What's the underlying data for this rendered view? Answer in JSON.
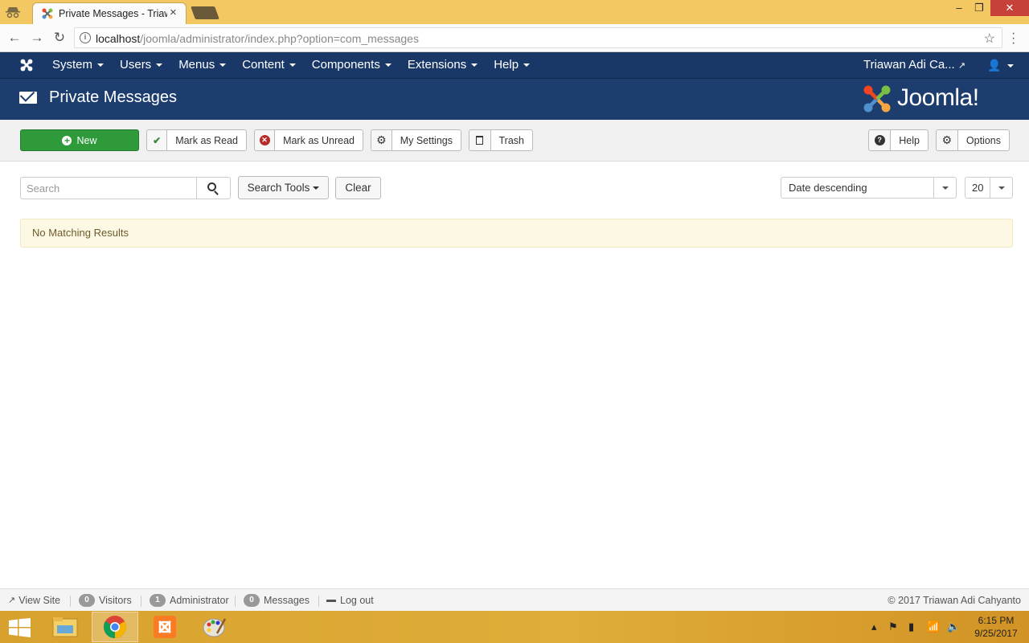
{
  "browser": {
    "tab_title": "Private Messages - Triawan Adi Cahyanto - Administration",
    "url_host": "localhost",
    "url_path": "/joomla/administrator/index.php?option=com_messages",
    "window_controls": {
      "minimize": "–",
      "maximize": "❐",
      "close": "✕"
    }
  },
  "topnav": {
    "menu": [
      {
        "label": "System"
      },
      {
        "label": "Users"
      },
      {
        "label": "Menus"
      },
      {
        "label": "Content"
      },
      {
        "label": "Components"
      },
      {
        "label": "Extensions"
      },
      {
        "label": "Help"
      }
    ],
    "user_name": "Triawan Adi Ca...",
    "user_icon": "user-icon"
  },
  "header": {
    "title": "Private Messages",
    "brand": "Joomla!"
  },
  "toolbar": {
    "new_label": "New",
    "mark_read_label": "Mark as Read",
    "mark_unread_label": "Mark as Unread",
    "my_settings_label": "My Settings",
    "trash_label": "Trash",
    "help_label": "Help",
    "options_label": "Options"
  },
  "filters": {
    "search_placeholder": "Search",
    "search_tools_label": "Search Tools",
    "clear_label": "Clear",
    "ordering_value": "Date descending",
    "limit_value": "20"
  },
  "results": {
    "message": "No Matching Results"
  },
  "statusbar": {
    "view_site": "View Site",
    "visitors_count": "0",
    "visitors_label": "Visitors",
    "admin_count": "1",
    "admin_label": "Administrator",
    "messages_count": "0",
    "messages_label": "Messages",
    "logout": "Log out",
    "copyright": "© 2017 Triawan Adi Cahyanto"
  },
  "taskbar": {
    "time": "6:15 PM",
    "date": "9/25/2017"
  },
  "colors": {
    "nav_bg": "#1a3867",
    "header_bg": "#1c3d6e",
    "new_button": "#2f9a3a",
    "alert_bg": "#fcf8e3"
  }
}
